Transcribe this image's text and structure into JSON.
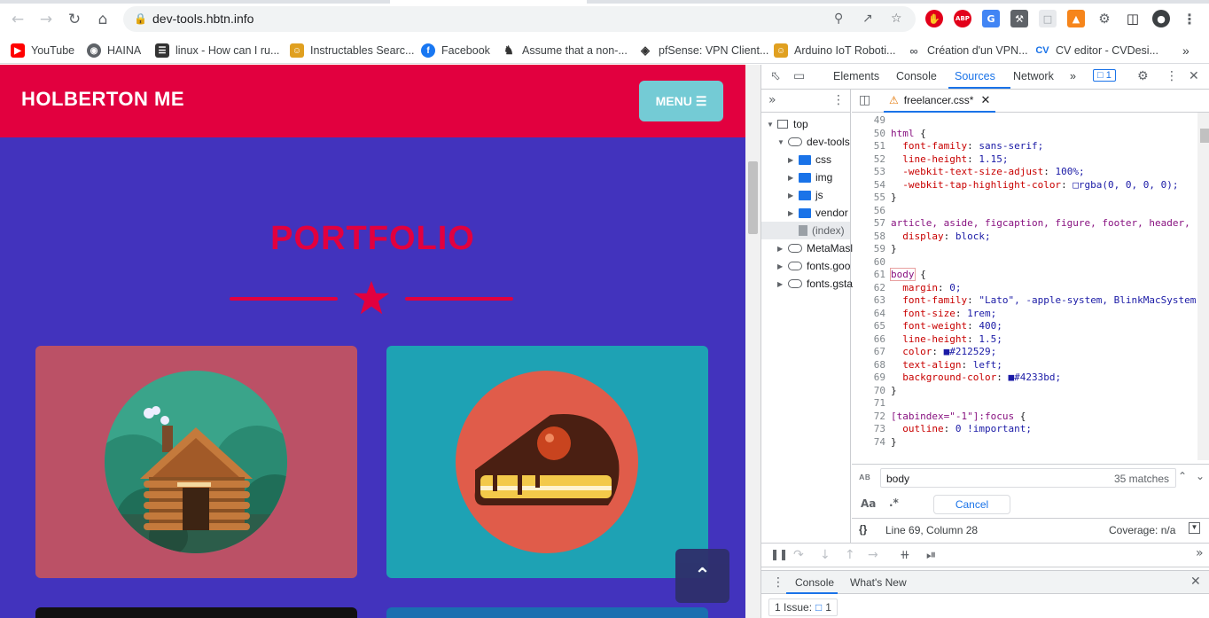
{
  "browser": {
    "url": "dev-tools.hbtn.info",
    "bookmarks": [
      {
        "label": "YouTube",
        "icon": "youtube-icon",
        "color": "#ff0000"
      },
      {
        "label": "HAINA",
        "icon": "globe-icon",
        "color": "#5f6368"
      },
      {
        "label": "linux - How can I ru...",
        "icon": "stackexchange-icon",
        "color": "#333333"
      },
      {
        "label": "Instructables Searc...",
        "icon": "instructables-icon",
        "color": "#e0a020"
      },
      {
        "label": "Facebook",
        "icon": "facebook-icon",
        "color": "#1877f2"
      },
      {
        "label": "Assume that a non-...",
        "icon": "chess-icon",
        "color": "#333333"
      },
      {
        "label": "pfSense: VPN Client...",
        "icon": "linux-icon",
        "color": "#333333"
      },
      {
        "label": "Arduino IoT Roboti...",
        "icon": "instructables-icon",
        "color": "#e0a020"
      },
      {
        "label": "Création d'un VPN...",
        "icon": "link-icon",
        "color": "#5f6368"
      },
      {
        "label": "CV editor - CVDesi...",
        "icon": "cv-icon",
        "color": "#1a73e8"
      }
    ],
    "more_bookmarks": "»"
  },
  "site": {
    "brand": "HOLBERTON ME",
    "menu_label": "MENU",
    "section_title": "PORTFOLIO",
    "colors": {
      "header": "#e2003f",
      "background": "#4233bd",
      "menu": "#74cbd5"
    }
  },
  "devtools": {
    "tabs": [
      "Elements",
      "Console",
      "Sources",
      "Network"
    ],
    "active_tab": "Sources",
    "more_tabs": "»",
    "issues_count": "1",
    "tree": {
      "top": "top",
      "domain": "dev-tools",
      "folders": [
        "css",
        "img",
        "js",
        "vendor"
      ],
      "index": "(index)",
      "others": [
        "MetaMasl",
        "fonts.goo",
        "fonts.gsta"
      ]
    },
    "file_tab": "freelancer.css*",
    "code_lines": [
      {
        "n": "49",
        "text": ""
      },
      {
        "n": "50",
        "text": "html {"
      },
      {
        "n": "51",
        "text": "  font-family: sans-serif;"
      },
      {
        "n": "52",
        "text": "  line-height: 1.15;"
      },
      {
        "n": "53",
        "text": "  -webkit-text-size-adjust: 100%;"
      },
      {
        "n": "54",
        "text": "  -webkit-tap-highlight-color: □rgba(0, 0, 0, 0);"
      },
      {
        "n": "55",
        "text": "}"
      },
      {
        "n": "56",
        "text": ""
      },
      {
        "n": "57",
        "text": "article, aside, figcaption, figure, footer, header,"
      },
      {
        "n": "58",
        "text": "  display: block;"
      },
      {
        "n": "59",
        "text": "}"
      },
      {
        "n": "60",
        "text": ""
      },
      {
        "n": "61",
        "text": "body {"
      },
      {
        "n": "62",
        "text": "  margin: 0;"
      },
      {
        "n": "63",
        "text": "  font-family: \"Lato\", -apple-system, BlinkMacSystem"
      },
      {
        "n": "64",
        "text": "  font-size: 1rem;"
      },
      {
        "n": "65",
        "text": "  font-weight: 400;"
      },
      {
        "n": "66",
        "text": "  line-height: 1.5;"
      },
      {
        "n": "67",
        "text": "  color: ■#212529;"
      },
      {
        "n": "68",
        "text": "  text-align: left;"
      },
      {
        "n": "69",
        "text": "  background-color: ■#4233bd;"
      },
      {
        "n": "70",
        "text": "}"
      },
      {
        "n": "71",
        "text": ""
      },
      {
        "n": "72",
        "text": "[tabindex=\"-1\"]:focus {"
      },
      {
        "n": "73",
        "text": "  outline: 0 !important;"
      },
      {
        "n": "74",
        "text": "}"
      }
    ],
    "search": {
      "query": "body",
      "matches": "35 matches",
      "cancel": "Cancel",
      "case_label": "Aa",
      "regex_label": ".*"
    },
    "status": {
      "position": "Line 69, Column 28",
      "coverage": "Coverage: n/a",
      "braces": "{}"
    },
    "drawer_tabs": [
      "Console",
      "What's New"
    ],
    "issue_label": "1 Issue:",
    "issue_count": "1"
  }
}
